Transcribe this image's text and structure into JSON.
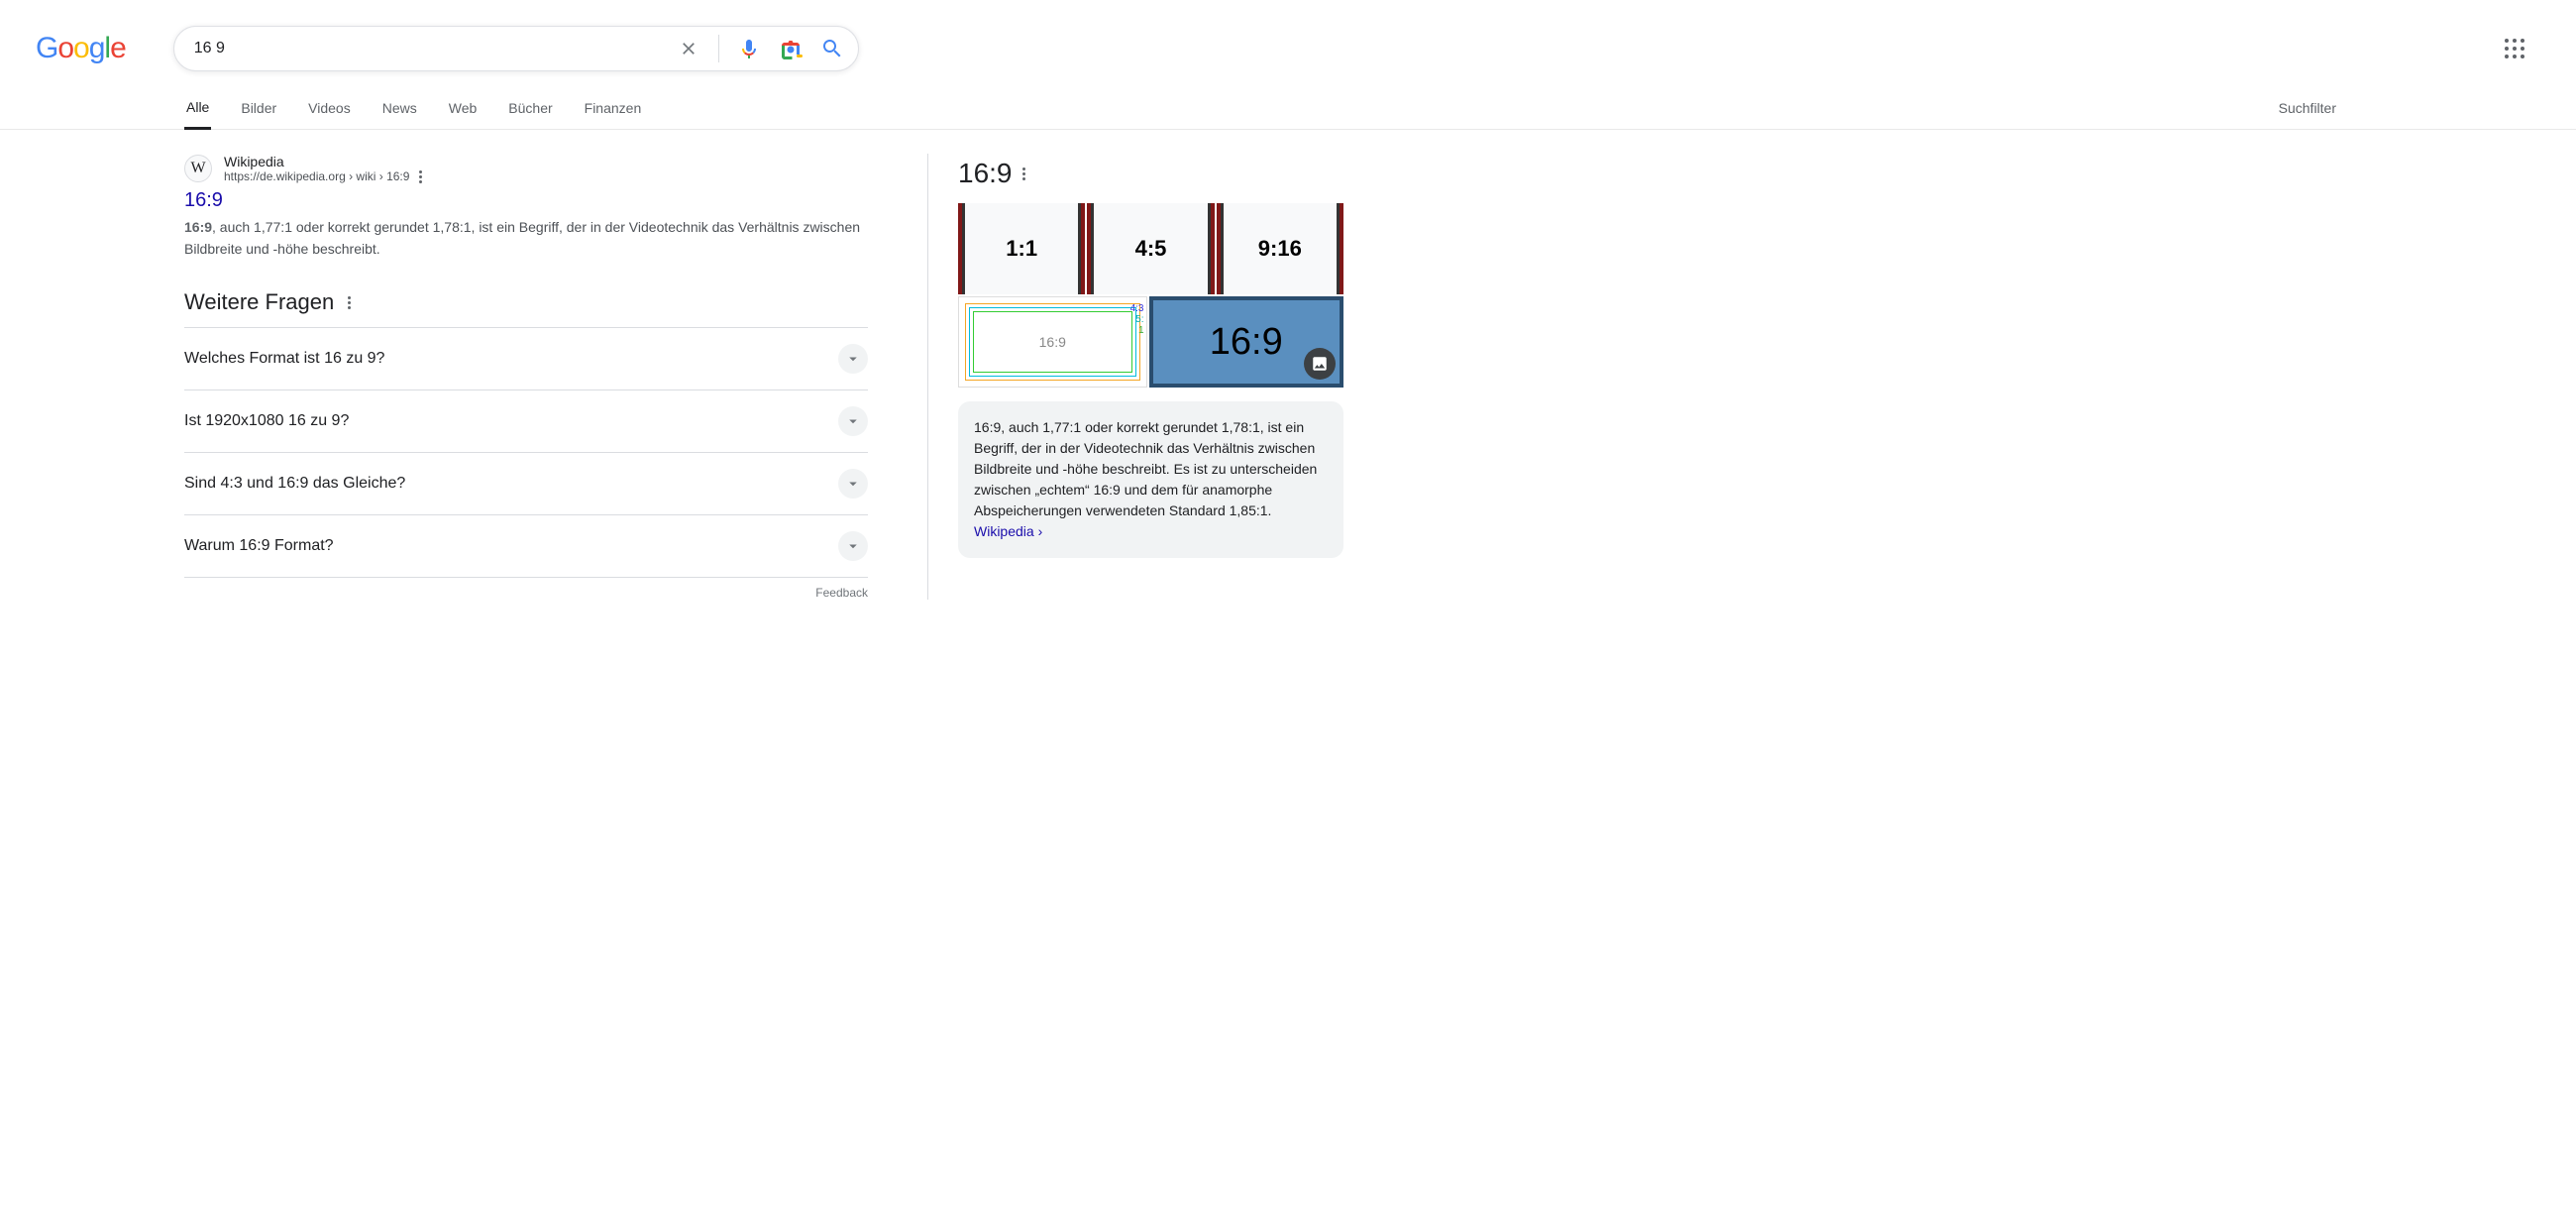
{
  "logo_letters": [
    "G",
    "o",
    "o",
    "g",
    "l",
    "e"
  ],
  "search": {
    "query": "16 9"
  },
  "tabs": {
    "items": [
      "Alle",
      "Bilder",
      "Videos",
      "News",
      "Web",
      "Bücher",
      "Finanzen"
    ],
    "active": 0,
    "filter": "Suchfilter"
  },
  "result1": {
    "source": "Wikipedia",
    "url_display": "https://de.wikipedia.org › wiki › 16:9",
    "title": "16:9",
    "snippet_bold": "16:9",
    "snippet_rest": ", auch 1,77:1 oder korrekt gerundet 1,78:1, ist ein Begriff, der in der Videotechnik das Verhältnis zwischen Bildbreite und -höhe beschreibt.",
    "favicon_letter": "W"
  },
  "paa": {
    "title": "Weitere Fragen",
    "items": [
      "Welches Format ist 16 zu 9?",
      "Ist 1920x1080 16 zu 9?",
      "Sind 4:3 und 16:9 das Gleiche?",
      "Warum 16:9 Format?"
    ],
    "feedback": "Feedback"
  },
  "kp": {
    "title": "16:9",
    "ratios": [
      "1:1",
      "4:5",
      "9:16"
    ],
    "diagram_center": "16:9",
    "diagram_labels": [
      "4:3",
      "5:",
      "1"
    ],
    "big_label": "16:9",
    "desc": "16:9, auch 1,77:1 oder korrekt gerundet 1,78:1, ist ein Begriff, der in der Videotechnik das Verhältnis zwischen Bildbreite und -höhe beschreibt. Es ist zu unterscheiden zwischen „echtem“ 16:9 und dem für anamorphe Abspeicherungen verwendeten Standard 1,85:1. ",
    "wiki": "Wikipedia"
  }
}
